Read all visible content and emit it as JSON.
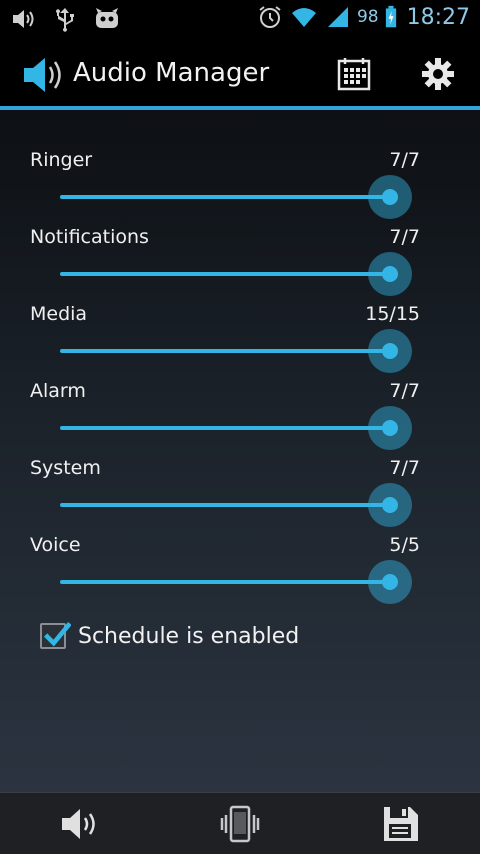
{
  "status_bar": {
    "battery_level": "98",
    "time": "18:27",
    "icons": [
      "volume-icon",
      "usb-icon",
      "cyanogenmod-icon",
      "alarm-icon",
      "wifi-icon",
      "signal-icon",
      "battery-charging-icon"
    ]
  },
  "action_bar": {
    "title": "Audio Manager",
    "app_icon": "speaker-icon",
    "actions": [
      "calendar-icon",
      "settings-icon"
    ]
  },
  "volumes": [
    {
      "label": "Ringer",
      "value_text": "7/7",
      "level": 1.0
    },
    {
      "label": "Notifications",
      "value_text": "7/7",
      "level": 1.0
    },
    {
      "label": "Media",
      "value_text": "15/15",
      "level": 1.0
    },
    {
      "label": "Alarm",
      "value_text": "7/7",
      "level": 1.0
    },
    {
      "label": "System",
      "value_text": "7/7",
      "level": 1.0
    },
    {
      "label": "Voice",
      "value_text": "5/5",
      "level": 1.0
    }
  ],
  "schedule": {
    "label": "Schedule is enabled",
    "checked": true
  },
  "bottom_bar": {
    "buttons": [
      "sound-mode-icon",
      "vibrate-mode-icon",
      "save-icon"
    ]
  },
  "colors": {
    "accent": "#33b5e5",
    "status_text": "#8fc8e8"
  }
}
